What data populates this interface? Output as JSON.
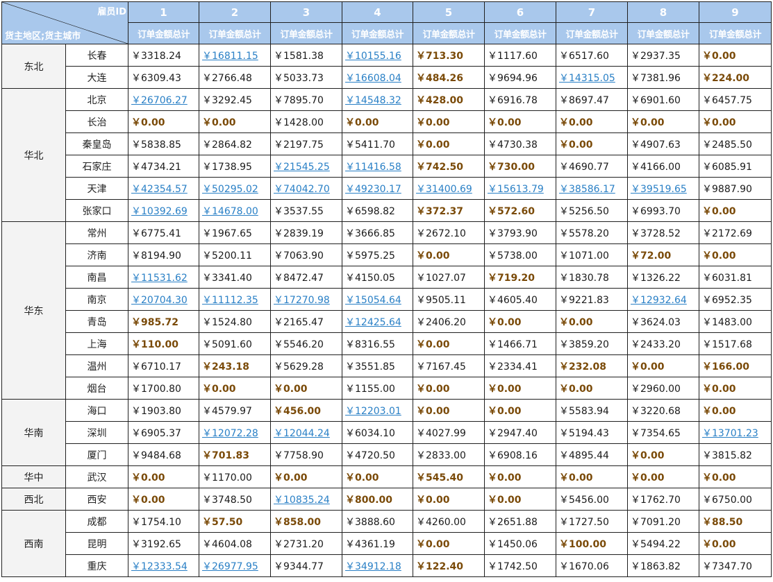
{
  "header": {
    "employee_id_label": "雇员ID",
    "region_city_label": "货主地区;货主城市",
    "employee_ids": [
      "1",
      "2",
      "3",
      "4",
      "5",
      "6",
      "7",
      "8",
      "9"
    ],
    "metric_label": "订单金额总计"
  },
  "colors": {
    "header_bg": "#a9c8ec",
    "link": "#2a80c6",
    "low": "#7a4a08"
  },
  "groups": [
    {
      "region": "东北",
      "rows": [
        {
          "city": "长春",
          "cells": [
            [
              "￥3318.24",
              "n"
            ],
            [
              "￥16811.15",
              "h"
            ],
            [
              "￥1581.38",
              "n"
            ],
            [
              "￥10155.16",
              "h"
            ],
            [
              "￥713.30",
              "l"
            ],
            [
              "￥1117.60",
              "n"
            ],
            [
              "￥6517.60",
              "n"
            ],
            [
              "￥2937.35",
              "n"
            ],
            [
              "￥0.00",
              "l"
            ]
          ]
        },
        {
          "city": "大连",
          "cells": [
            [
              "￥6309.43",
              "n"
            ],
            [
              "￥2766.48",
              "n"
            ],
            [
              "￥5033.73",
              "n"
            ],
            [
              "￥16608.04",
              "h"
            ],
            [
              "￥484.26",
              "l"
            ],
            [
              "￥9694.96",
              "n"
            ],
            [
              "￥14315.05",
              "h"
            ],
            [
              "￥7381.96",
              "n"
            ],
            [
              "￥224.00",
              "l"
            ]
          ]
        }
      ]
    },
    {
      "region": "华北",
      "rows": [
        {
          "city": "北京",
          "cells": [
            [
              "￥26706.27",
              "h"
            ],
            [
              "￥3292.45",
              "n"
            ],
            [
              "￥7895.70",
              "n"
            ],
            [
              "￥14548.32",
              "h"
            ],
            [
              "￥428.00",
              "l"
            ],
            [
              "￥6916.78",
              "n"
            ],
            [
              "￥8697.47",
              "n"
            ],
            [
              "￥6901.60",
              "n"
            ],
            [
              "￥6457.75",
              "n"
            ]
          ]
        },
        {
          "city": "长治",
          "cells": [
            [
              "￥0.00",
              "l"
            ],
            [
              "￥0.00",
              "l"
            ],
            [
              "￥1428.00",
              "n"
            ],
            [
              "￥0.00",
              "l"
            ],
            [
              "￥0.00",
              "l"
            ],
            [
              "￥0.00",
              "l"
            ],
            [
              "￥0.00",
              "l"
            ],
            [
              "￥0.00",
              "l"
            ],
            [
              "￥0.00",
              "l"
            ]
          ]
        },
        {
          "city": "秦皇岛",
          "cells": [
            [
              "￥5838.85",
              "n"
            ],
            [
              "￥2864.82",
              "n"
            ],
            [
              "￥2197.75",
              "n"
            ],
            [
              "￥5411.70",
              "n"
            ],
            [
              "￥0.00",
              "l"
            ],
            [
              "￥4730.38",
              "n"
            ],
            [
              "￥0.00",
              "l"
            ],
            [
              "￥4907.63",
              "n"
            ],
            [
              "￥2485.50",
              "n"
            ]
          ]
        },
        {
          "city": "石家庄",
          "cells": [
            [
              "￥4734.21",
              "n"
            ],
            [
              "￥1738.95",
              "n"
            ],
            [
              "￥21545.25",
              "h"
            ],
            [
              "￥11416.58",
              "h"
            ],
            [
              "￥742.50",
              "l"
            ],
            [
              "￥730.00",
              "l"
            ],
            [
              "￥4690.77",
              "n"
            ],
            [
              "￥4166.00",
              "n"
            ],
            [
              "￥6085.91",
              "n"
            ]
          ]
        },
        {
          "city": "天津",
          "cells": [
            [
              "￥42354.57",
              "h"
            ],
            [
              "￥50295.02",
              "h"
            ],
            [
              "￥74042.70",
              "h"
            ],
            [
              "￥49230.17",
              "h"
            ],
            [
              "￥31400.69",
              "h"
            ],
            [
              "￥15613.79",
              "h"
            ],
            [
              "￥38586.17",
              "h"
            ],
            [
              "￥39519.65",
              "h"
            ],
            [
              "￥9887.90",
              "n"
            ]
          ]
        },
        {
          "city": "张家口",
          "cells": [
            [
              "￥10392.69",
              "h"
            ],
            [
              "￥14678.00",
              "h"
            ],
            [
              "￥3537.55",
              "n"
            ],
            [
              "￥6598.82",
              "n"
            ],
            [
              "￥372.37",
              "l"
            ],
            [
              "￥572.60",
              "l"
            ],
            [
              "￥5256.50",
              "n"
            ],
            [
              "￥6993.70",
              "n"
            ],
            [
              "￥0.00",
              "l"
            ]
          ]
        }
      ]
    },
    {
      "region": "华东",
      "rows": [
        {
          "city": "常州",
          "cells": [
            [
              "￥6775.41",
              "n"
            ],
            [
              "￥1967.65",
              "n"
            ],
            [
              "￥2839.19",
              "n"
            ],
            [
              "￥3666.85",
              "n"
            ],
            [
              "￥2672.10",
              "n"
            ],
            [
              "￥3793.90",
              "n"
            ],
            [
              "￥5578.20",
              "n"
            ],
            [
              "￥3728.52",
              "n"
            ],
            [
              "￥2172.69",
              "n"
            ]
          ]
        },
        {
          "city": "济南",
          "cells": [
            [
              "￥8194.90",
              "n"
            ],
            [
              "￥5200.11",
              "n"
            ],
            [
              "￥7063.90",
              "n"
            ],
            [
              "￥5975.25",
              "n"
            ],
            [
              "￥0.00",
              "l"
            ],
            [
              "￥5738.00",
              "n"
            ],
            [
              "￥1071.00",
              "n"
            ],
            [
              "￥72.00",
              "l"
            ],
            [
              "￥0.00",
              "l"
            ]
          ]
        },
        {
          "city": "南昌",
          "cells": [
            [
              "￥11531.62",
              "h"
            ],
            [
              "￥3341.40",
              "n"
            ],
            [
              "￥8472.47",
              "n"
            ],
            [
              "￥4150.05",
              "n"
            ],
            [
              "￥1027.07",
              "n"
            ],
            [
              "￥719.20",
              "l"
            ],
            [
              "￥1830.78",
              "n"
            ],
            [
              "￥1326.22",
              "n"
            ],
            [
              "￥6031.81",
              "n"
            ]
          ]
        },
        {
          "city": "南京",
          "cells": [
            [
              "￥20704.30",
              "h"
            ],
            [
              "￥11112.35",
              "h"
            ],
            [
              "￥17270.98",
              "h"
            ],
            [
              "￥15054.64",
              "h"
            ],
            [
              "￥9505.11",
              "n"
            ],
            [
              "￥4605.40",
              "n"
            ],
            [
              "￥9221.83",
              "n"
            ],
            [
              "￥12932.64",
              "h"
            ],
            [
              "￥6952.35",
              "n"
            ]
          ]
        },
        {
          "city": "青岛",
          "cells": [
            [
              "￥985.72",
              "l"
            ],
            [
              "￥1524.80",
              "n"
            ],
            [
              "￥2165.47",
              "n"
            ],
            [
              "￥12425.64",
              "h"
            ],
            [
              "￥2406.20",
              "n"
            ],
            [
              "￥0.00",
              "l"
            ],
            [
              "￥0.00",
              "l"
            ],
            [
              "￥3624.03",
              "n"
            ],
            [
              "￥1483.00",
              "n"
            ]
          ]
        },
        {
          "city": "上海",
          "cells": [
            [
              "￥110.00",
              "l"
            ],
            [
              "￥5091.60",
              "n"
            ],
            [
              "￥5546.20",
              "n"
            ],
            [
              "￥8316.55",
              "n"
            ],
            [
              "￥0.00",
              "l"
            ],
            [
              "￥1466.71",
              "n"
            ],
            [
              "￥3859.20",
              "n"
            ],
            [
              "￥2433.20",
              "n"
            ],
            [
              "￥1517.68",
              "n"
            ]
          ]
        },
        {
          "city": "温州",
          "cells": [
            [
              "￥6710.17",
              "n"
            ],
            [
              "￥243.18",
              "l"
            ],
            [
              "￥5629.28",
              "n"
            ],
            [
              "￥3551.85",
              "n"
            ],
            [
              "￥7167.45",
              "n"
            ],
            [
              "￥2334.41",
              "n"
            ],
            [
              "￥232.08",
              "l"
            ],
            [
              "￥0.00",
              "l"
            ],
            [
              "￥166.00",
              "l"
            ]
          ]
        },
        {
          "city": "烟台",
          "cells": [
            [
              "￥1700.80",
              "n"
            ],
            [
              "￥0.00",
              "l"
            ],
            [
              "￥0.00",
              "l"
            ],
            [
              "￥1155.00",
              "n"
            ],
            [
              "￥0.00",
              "l"
            ],
            [
              "￥0.00",
              "l"
            ],
            [
              "￥0.00",
              "l"
            ],
            [
              "￥2960.00",
              "n"
            ],
            [
              "￥0.00",
              "l"
            ]
          ]
        }
      ]
    },
    {
      "region": "华南",
      "rows": [
        {
          "city": "海口",
          "cells": [
            [
              "￥1903.80",
              "n"
            ],
            [
              "￥4579.97",
              "n"
            ],
            [
              "￥456.00",
              "l"
            ],
            [
              "￥12203.01",
              "h"
            ],
            [
              "￥0.00",
              "l"
            ],
            [
              "￥0.00",
              "l"
            ],
            [
              "￥5583.94",
              "n"
            ],
            [
              "￥3220.68",
              "n"
            ],
            [
              "￥0.00",
              "l"
            ]
          ]
        },
        {
          "city": "深圳",
          "cells": [
            [
              "￥6905.37",
              "n"
            ],
            [
              "￥12072.28",
              "h"
            ],
            [
              "￥12044.24",
              "h"
            ],
            [
              "￥6034.10",
              "n"
            ],
            [
              "￥4027.99",
              "n"
            ],
            [
              "￥2947.40",
              "n"
            ],
            [
              "￥5194.43",
              "n"
            ],
            [
              "￥7354.65",
              "n"
            ],
            [
              "￥13701.23",
              "h"
            ]
          ]
        },
        {
          "city": "厦门",
          "cells": [
            [
              "￥9484.68",
              "n"
            ],
            [
              "￥701.83",
              "l"
            ],
            [
              "￥7758.90",
              "n"
            ],
            [
              "￥4720.50",
              "n"
            ],
            [
              "￥2833.00",
              "n"
            ],
            [
              "￥6908.16",
              "n"
            ],
            [
              "￥4895.44",
              "n"
            ],
            [
              "￥0.00",
              "l"
            ],
            [
              "￥3815.82",
              "n"
            ]
          ]
        }
      ]
    },
    {
      "region": "华中",
      "rows": [
        {
          "city": "武汉",
          "cells": [
            [
              "￥0.00",
              "l"
            ],
            [
              "￥1170.00",
              "n"
            ],
            [
              "￥0.00",
              "l"
            ],
            [
              "￥0.00",
              "l"
            ],
            [
              "￥545.40",
              "l"
            ],
            [
              "￥0.00",
              "l"
            ],
            [
              "￥0.00",
              "l"
            ],
            [
              "￥0.00",
              "l"
            ],
            [
              "￥0.00",
              "l"
            ]
          ]
        }
      ]
    },
    {
      "region": "西北",
      "rows": [
        {
          "city": "西安",
          "cells": [
            [
              "￥0.00",
              "l"
            ],
            [
              "￥3748.50",
              "n"
            ],
            [
              "￥10835.24",
              "h"
            ],
            [
              "￥800.00",
              "l"
            ],
            [
              "￥0.00",
              "l"
            ],
            [
              "￥0.00",
              "l"
            ],
            [
              "￥5456.00",
              "n"
            ],
            [
              "￥1762.70",
              "n"
            ],
            [
              "￥6750.00",
              "n"
            ]
          ]
        }
      ]
    },
    {
      "region": "西南",
      "rows": [
        {
          "city": "成都",
          "cells": [
            [
              "￥1754.10",
              "n"
            ],
            [
              "￥57.50",
              "l"
            ],
            [
              "￥858.00",
              "l"
            ],
            [
              "￥3888.60",
              "n"
            ],
            [
              "￥4260.00",
              "n"
            ],
            [
              "￥2651.88",
              "n"
            ],
            [
              "￥1727.50",
              "n"
            ],
            [
              "￥7091.20",
              "n"
            ],
            [
              "￥88.50",
              "l"
            ]
          ]
        },
        {
          "city": "昆明",
          "cells": [
            [
              "￥3192.65",
              "n"
            ],
            [
              "￥4604.08",
              "n"
            ],
            [
              "￥2731.20",
              "n"
            ],
            [
              "￥4361.19",
              "n"
            ],
            [
              "￥0.00",
              "l"
            ],
            [
              "￥1450.06",
              "n"
            ],
            [
              "￥100.00",
              "l"
            ],
            [
              "￥5494.22",
              "n"
            ],
            [
              "￥0.00",
              "l"
            ]
          ]
        },
        {
          "city": "重庆",
          "cells": [
            [
              "￥12333.54",
              "h"
            ],
            [
              "￥26977.95",
              "h"
            ],
            [
              "￥9344.77",
              "n"
            ],
            [
              "￥34912.18",
              "h"
            ],
            [
              "￥122.40",
              "l"
            ],
            [
              "￥1742.50",
              "n"
            ],
            [
              "￥1670.06",
              "n"
            ],
            [
              "￥1863.82",
              "n"
            ],
            [
              "￥7347.70",
              "n"
            ]
          ]
        }
      ]
    }
  ]
}
